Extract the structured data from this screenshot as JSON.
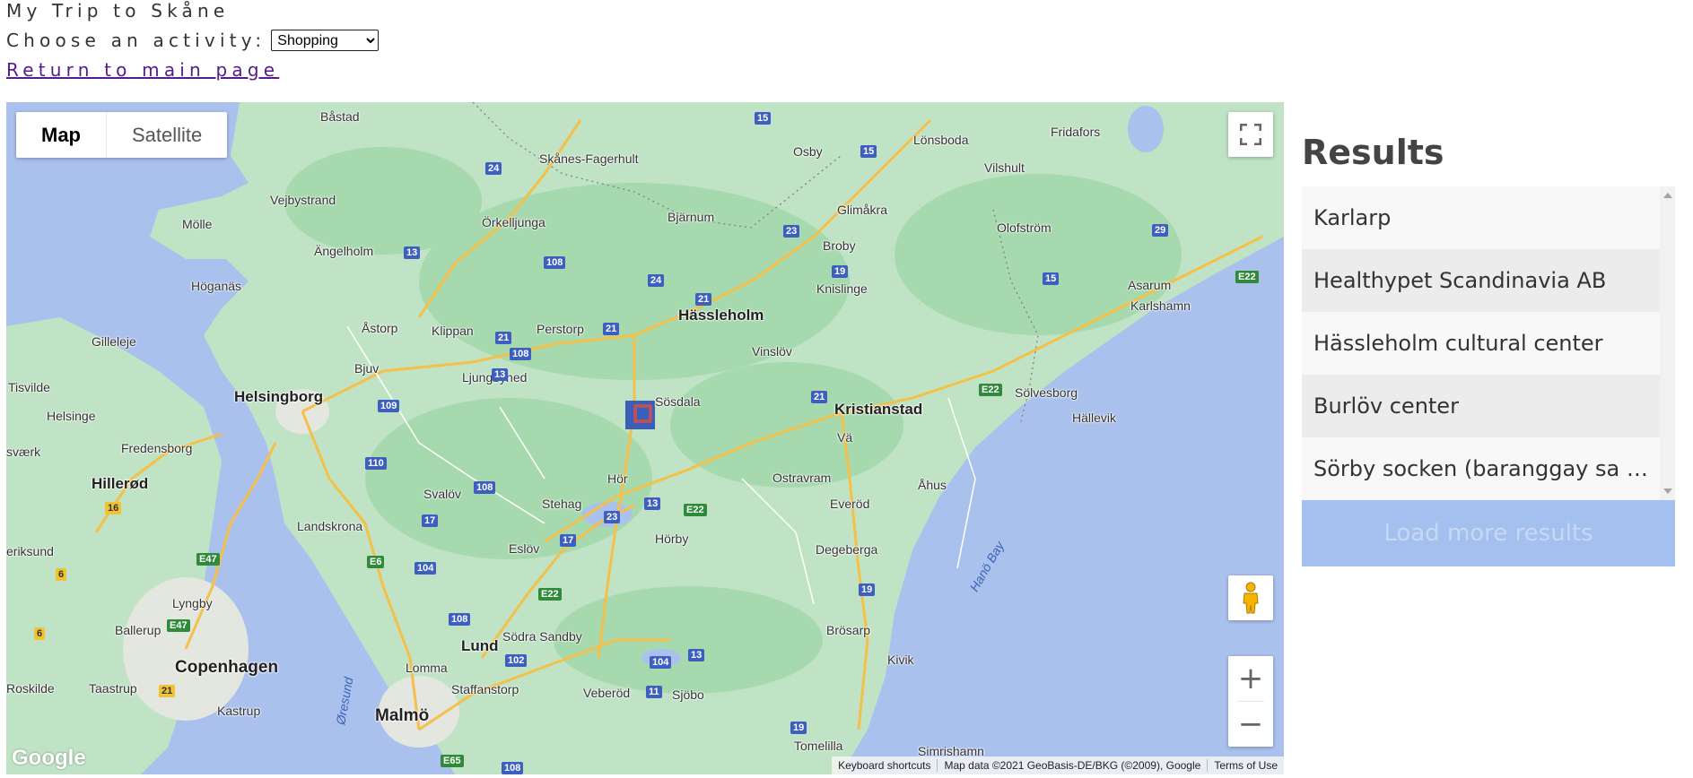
{
  "header": {
    "title": "My Trip to Skåne",
    "choose_label": "Choose an activity:",
    "activity_selected": "Shopping",
    "return_link": "Return to main page"
  },
  "map": {
    "type_control": {
      "map_label": "Map",
      "satellite_label": "Satellite",
      "active": "Map"
    },
    "controls": {
      "fullscreen_icon": "fullscreen-icon",
      "pegman_icon": "pegman-icon",
      "zoom_in": "+",
      "zoom_out": "−"
    },
    "logo": "Google",
    "attribution": {
      "keyboard": "Keyboard shortcuts",
      "data": "Map data ©2021 GeoBasis-DE/BKG (©2009), Google",
      "terms": "Terms of Use"
    },
    "places": [
      "Båstad",
      "Skånes-Fagerhult",
      "Osby",
      "Lönsboda",
      "Fridafors",
      "Vejbystrand",
      "Vilshult",
      "Glimåkra",
      "Mölle",
      "Ängelholm",
      "Örkelljunga",
      "Bjärnum",
      "Olofström",
      "Broby",
      "Höganäs",
      "Knislinge",
      "Asarum",
      "Karlshamn",
      "Hässleholm",
      "Åstorp",
      "Klippan",
      "Perstorp",
      "Vinslöv",
      "Gilleleje",
      "Bjuv",
      "Ljungbyhed",
      "Sölvesborg",
      "Tisvilde",
      "Helsingborg",
      "Sösdala",
      "Kristianstad",
      "Hällevik",
      "Helsinge",
      "Fredensborg",
      "Vä",
      "Hillerød",
      "Hör",
      "Ostravram",
      "Åhus",
      "Svalöv",
      "Stehag",
      "Everöd",
      "Landskrona",
      "Eslöv",
      "Hörby",
      "Degeberga",
      "Lyngby",
      "Ballerup",
      "Lund",
      "Södra Sandby",
      "Brösarp",
      "Copenhagen",
      "Lomma",
      "Kivik",
      "Taastrup",
      "Staffanstorp",
      "Veberöd",
      "Sjöbo",
      "Kastrup",
      "Malmö",
      "Tomelilla",
      "Simrishamn",
      "Roskilde",
      "Hanö Bay",
      "Øresund",
      "sværk",
      "eriksund"
    ],
    "shields": [
      "15",
      "24",
      "15",
      "13",
      "108",
      "23",
      "19",
      "29",
      "24",
      "21",
      "15",
      "E22",
      "21",
      "21",
      "108",
      "13",
      "21",
      "109",
      "E22",
      "110",
      "108",
      "16",
      "17",
      "13",
      "E22",
      "23",
      "E47",
      "E6",
      "104",
      "17",
      "6",
      "E22",
      "19",
      "E47",
      "6",
      "108",
      "21",
      "102",
      "104",
      "13",
      "11",
      "19",
      "E65",
      "108"
    ]
  },
  "results": {
    "title": "Results",
    "items": [
      "Karlarp",
      "Healthypet Scandinavia AB",
      "Hässleholm cultural center",
      "Burlöv center",
      "Sörby socken (baranggay sa Suwesya)"
    ],
    "load_more": "Load more results"
  },
  "colors": {
    "water": "#aac1ee",
    "land": "#bfe3c4",
    "forest": "#a6d9ae",
    "road": "#f5c04a",
    "load_more_bg": "#a4c0ee"
  }
}
